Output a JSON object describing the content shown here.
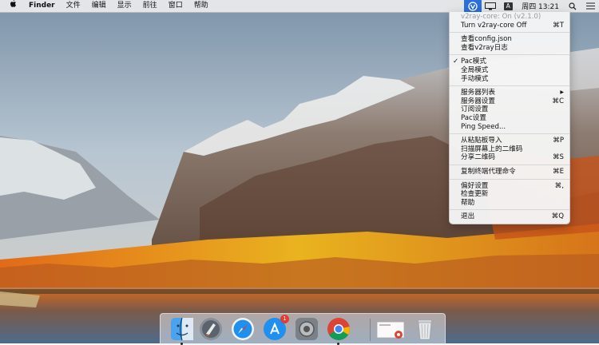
{
  "menubar": {
    "app_name": "Finder",
    "menus": [
      "文件",
      "编辑",
      "显示",
      "前往",
      "窗口",
      "帮助"
    ],
    "clock": "周四 13:21",
    "status_icons": [
      "v2ray-icon",
      "display-mirror-icon",
      "input-method-icon",
      "search-icon",
      "list-icon"
    ],
    "input_method_label": "A"
  },
  "v2ray_menu": {
    "status": "v2ray-core: On  (v2.1.0)",
    "items": [
      {
        "label": "Turn v2ray-core Off",
        "shortcut": "⌘T"
      },
      {
        "label": "查看config.json",
        "shortcut": ""
      },
      {
        "label": "查看v2ray日志",
        "shortcut": ""
      },
      {
        "label": "Pac模式",
        "shortcut": "",
        "checked": true
      },
      {
        "label": "全局模式",
        "shortcut": ""
      },
      {
        "label": "手动模式",
        "shortcut": ""
      },
      {
        "label": "服务器列表",
        "shortcut": "▶"
      },
      {
        "label": "服务器设置",
        "shortcut": "⌘C"
      },
      {
        "label": "订阅设置",
        "shortcut": ""
      },
      {
        "label": "Pac设置",
        "shortcut": ""
      },
      {
        "label": "Ping Speed...",
        "shortcut": ""
      },
      {
        "label": "从粘贴板导入",
        "shortcut": "⌘P"
      },
      {
        "label": "扫描屏幕上的二维码",
        "shortcut": ""
      },
      {
        "label": "分享二维码",
        "shortcut": "⌘S"
      },
      {
        "label": "复制终端代理命令",
        "shortcut": "⌘E"
      },
      {
        "label": "偏好设置",
        "shortcut": "⌘,"
      },
      {
        "label": "检查更新",
        "shortcut": ""
      },
      {
        "label": "帮助",
        "shortcut": ""
      },
      {
        "label": "退出",
        "shortcut": "⌘Q"
      }
    ],
    "checkmark": "✓"
  },
  "dock": {
    "apps": [
      "finder-icon",
      "launchpad-icon",
      "safari-icon",
      "app-store-icon",
      "system-preferences-icon",
      "chrome-icon",
      "document-preview-icon",
      "trash-icon"
    ],
    "app_store_badge": "1"
  },
  "colors": {
    "menu_highlight": "#2a6fdb",
    "sky": "#b9c9d6",
    "autumn_orange": "#e8781c",
    "autumn_yellow": "#e9c31c"
  }
}
